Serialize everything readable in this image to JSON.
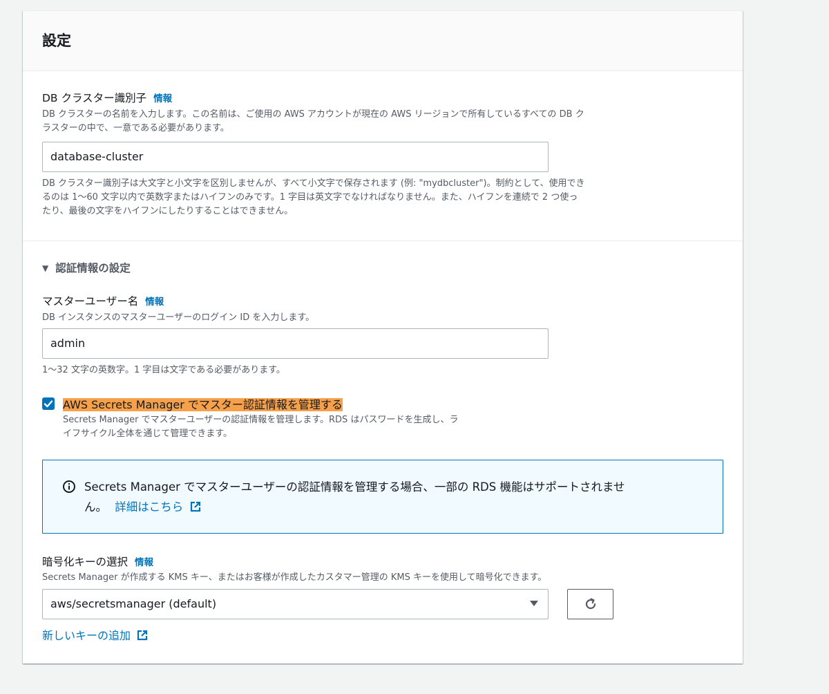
{
  "panel": {
    "title": "設定"
  },
  "cluster_id": {
    "label": "DB クラスター識別子",
    "info": "情報",
    "description_line1": "DB クラスターの名前を入力します。この名前は、ご使用の AWS アカウントが現在の AWS リージョンで所有しているすべての DB ク",
    "description_line2": "ラスターの中で、一意である必要があります。",
    "value": "database-cluster",
    "constraint_line1": "DB クラスター識別子は大文字と小文字を区別しませんが、すべて小文字で保存されます (例: \"mydbcluster\")。制約として、使用でき",
    "constraint_line2": "るのは 1〜60 文字以内で英数字またはハイフンのみです。1 字目は英文字でなければなりません。また、ハイフンを連続で 2 つ使っ",
    "constraint_line3": "たり、最後の文字をハイフンにしたりすることはできません。"
  },
  "credentials": {
    "section_title": "認証情報の設定",
    "toggle_icon": "caret-down-icon",
    "master_username": {
      "label": "マスターユーザー名",
      "info": "情報",
      "description": "DB インスタンスのマスターユーザーのログイン ID を入力します。",
      "value": "admin",
      "constraint": "1〜32 文字の英数字。1 字目は文字である必要があります。"
    },
    "secrets_manager_checkbox": {
      "checked": true,
      "label": "AWS Secrets Manager でマスター認証情報を管理する",
      "description_line1": "Secrets Manager でマスターユーザーの認証情報を管理します。RDS はパスワードを生成し、ラ",
      "description_line2": "イフサイクル全体を通じて管理できます。",
      "highlight_color": "#f7a04a"
    },
    "alert": {
      "icon": "info-icon",
      "text_line1": "Secrets Manager でマスターユーザーの認証情報を管理する場合、一部の RDS 機能はサポートされませ",
      "text_line2": "ん。",
      "link": "詳細はこちら",
      "link_icon": "external-link-icon"
    },
    "encryption_key": {
      "label": "暗号化キーの選択",
      "info": "情報",
      "description": "Secrets Manager が作成する KMS キー、またはお客様が作成したカスタマー管理の KMS キーを使用して暗号化できます。",
      "selected": "aws/secretsmanager (default)",
      "refresh_icon": "refresh-icon",
      "add_key_link": "新しいキーの追加",
      "add_key_icon": "external-link-icon"
    }
  },
  "colors": {
    "accent": "#0073bb",
    "page_bg": "#f2f3f3",
    "alert_bg": "#f1faff",
    "text_secondary": "#545b64"
  }
}
